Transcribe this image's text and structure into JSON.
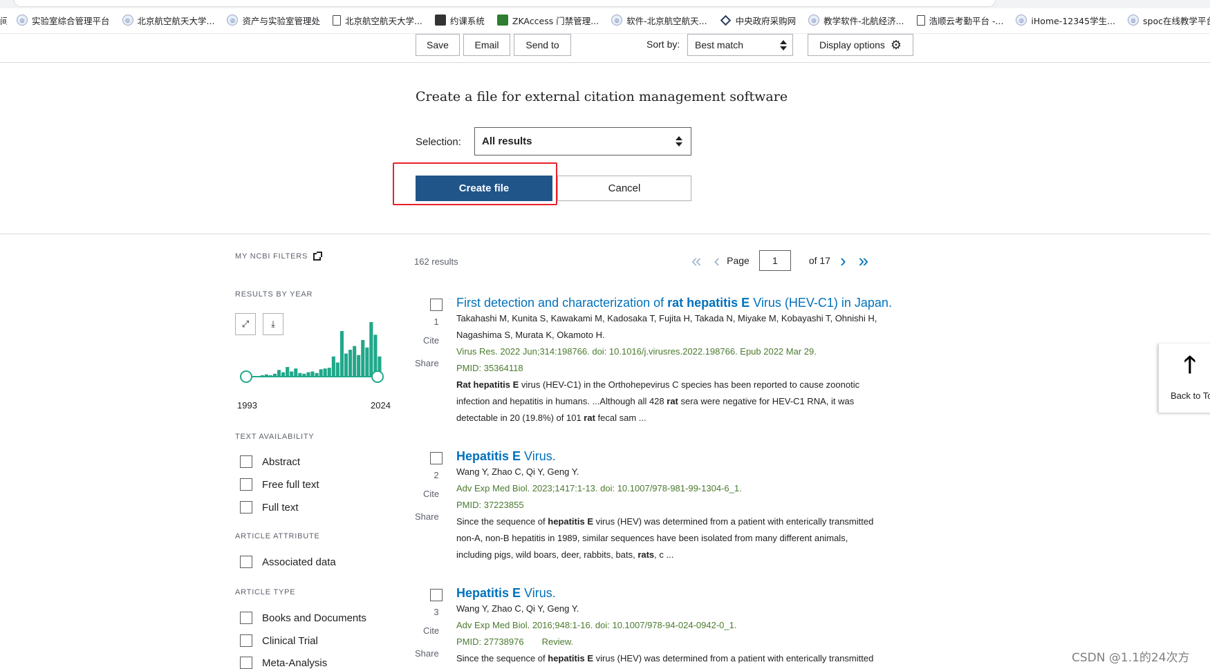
{
  "bookmarks": {
    "first": "间",
    "items": [
      {
        "label": "实验室综合管理平台",
        "icon": "globe-icon"
      },
      {
        "label": "北京航空航天大学...",
        "icon": "globe-icon"
      },
      {
        "label": "资产与实验室管理处",
        "icon": "globe-icon"
      },
      {
        "label": "北京航空航天大学...",
        "icon": "page-icon"
      },
      {
        "label": "约课系统",
        "icon": "image-icon"
      },
      {
        "label": "ZKAccess 门禁管理...",
        "icon": "chart-icon"
      },
      {
        "label": "软件-北京航空航天...",
        "icon": "globe-icon"
      },
      {
        "label": "中央政府采购网",
        "icon": "diamond-icon"
      },
      {
        "label": "教学软件-北航经济...",
        "icon": "globe-icon"
      },
      {
        "label": "浩顺云考勤平台 -...",
        "icon": "page-icon"
      },
      {
        "label": "iHome-12345学生...",
        "icon": "globe-icon"
      },
      {
        "label": "spoc在线教学平台",
        "icon": "globe-icon"
      }
    ]
  },
  "toolbar": {
    "save": "Save",
    "email": "Email",
    "send_to": "Send to",
    "sort_label": "Sort by:",
    "sort_value": "Best match",
    "display_options": "Display options",
    "gear_glyph": "⚙"
  },
  "citation": {
    "title": "Create a file for external citation management software",
    "selection_label": "Selection:",
    "selection_value": "All results",
    "create_button": "Create file",
    "cancel_button": "Cancel"
  },
  "sidebar": {
    "my_filters": "MY NCBI FILTERS",
    "results_by_year": "RESULTS BY YEAR",
    "expand_glyph": "⤢",
    "download_glyph": "⤓",
    "year_start": "1993",
    "year_end": "2024",
    "year_histogram": [
      0,
      0,
      0,
      1,
      2,
      1,
      3,
      8,
      5,
      12,
      6,
      10,
      4,
      3,
      5,
      6,
      4,
      9,
      10,
      11,
      26,
      18,
      60,
      30,
      35,
      40,
      28,
      48,
      38,
      72,
      55,
      26
    ],
    "text_availability": "TEXT AVAILABILITY",
    "text_options": [
      "Abstract",
      "Free full text",
      "Full text"
    ],
    "article_attribute": "ARTICLE ATTRIBUTE",
    "attribute_options": [
      "Associated data"
    ],
    "article_type": "ARTICLE TYPE",
    "type_options": [
      "Books and Documents",
      "Clinical Trial",
      "Meta-Analysis"
    ]
  },
  "results": {
    "count": "162 results",
    "page_label": "Page",
    "page_value": "1",
    "of_pages": "of 17",
    "cite": "Cite",
    "share": "Share",
    "items": [
      {
        "num": "1",
        "title_pre": "First detection and characterization of ",
        "title_bold": "rat hepatitis E",
        "title_post": " Virus (HEV-C1) in Japan.",
        "authors_1": "Takahashi M, Kunita S, Kawakami M, Kadosaka T, Fujita H, Takada N, Miyake M, Kobayashi T, Ohnishi H,",
        "authors_2": "Nagashima S, Murata K, Okamoto H.",
        "citation": "Virus Res. 2022 Jun;314:198766. doi: 10.1016/j.virusres.2022.198766. Epub 2022 Mar 29.",
        "pmid": "PMID: 35364118",
        "snip1_b": "Rat hepatitis E",
        "snip1_post": " virus (HEV-C1) in the Orthohepevirus C species has been reported to cause zoonotic",
        "snip2_pre": "infection and hepatitis in humans. ...Although all 428 ",
        "snip2_b": "rat",
        "snip2_post": " sera were negative for HEV-C1 RNA, it was",
        "snip3_pre": "detectable in 20 (19.8%) of 101 ",
        "snip3_b": "rat",
        "snip3_post": " fecal sam ..."
      },
      {
        "num": "2",
        "title_bold": "Hepatitis E",
        "title_post": " Virus.",
        "authors_1": "Wang Y, Zhao C, Qi Y, Geng Y.",
        "citation": "Adv Exp Med Biol. 2023;1417:1-13. doi: 10.1007/978-981-99-1304-6_1.",
        "pmid": "PMID: 37223855",
        "snip1_pre": "Since the sequence of ",
        "snip1_b": "hepatitis E",
        "snip1_post": " virus (HEV) was determined from a patient with enterically transmitted",
        "snip2": "non-A, non-B hepatitis in 1989, similar sequences have been isolated from many different animals,",
        "snip3_pre": "including pigs, wild boars, deer, rabbits, bats, ",
        "snip3_b": "rats",
        "snip3_post": ", c ..."
      },
      {
        "num": "3",
        "title_bold": "Hepatitis E",
        "title_post": " Virus.",
        "authors_1": "Wang Y, Zhao C, Qi Y, Geng Y.",
        "citation": "Adv Exp Med Biol. 2016;948:1-16. doi: 10.1007/978-94-024-0942-0_1.",
        "pmid": "PMID: 27738976",
        "review": "Review.",
        "snip1_pre": "Since the sequence of ",
        "snip1_b": "hepatitis E",
        "snip1_post": " virus (HEV) was determined from a patient with enterically transmitted"
      }
    ]
  },
  "back_to_top": "Back to Top",
  "back_to_top_glyph": "🡑",
  "watermark": "CSDN @1.1的24次方",
  "colors": {
    "link": "#0071bc",
    "primary_button": "#20558a",
    "citation_green": "#4b7a2e",
    "highlight_red": "#e8202a",
    "histogram": "#20a88a"
  }
}
